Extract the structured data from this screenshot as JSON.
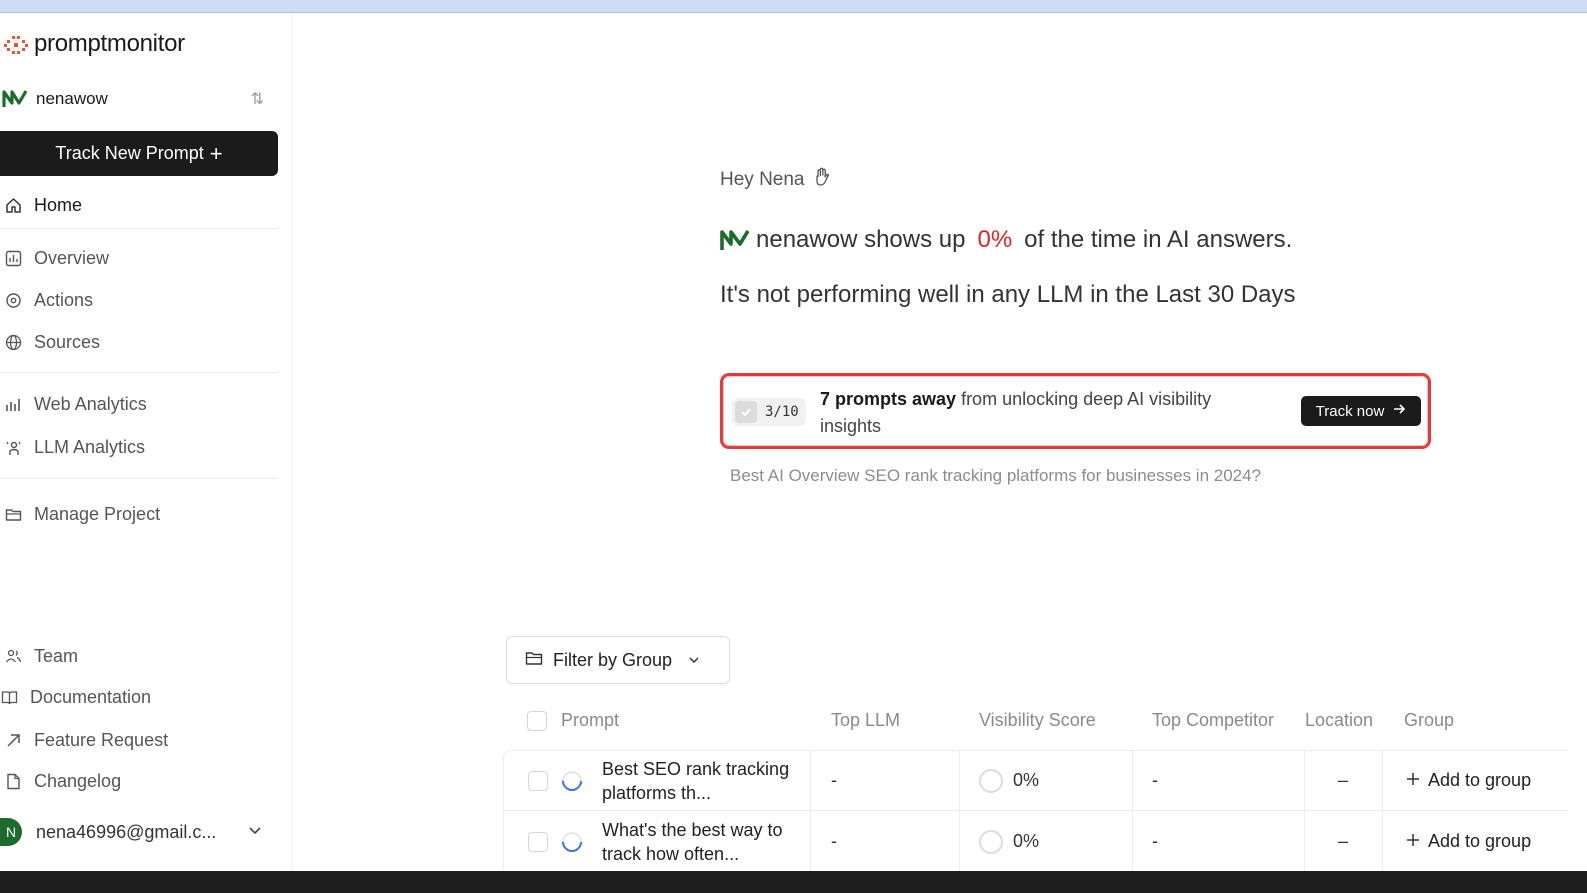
{
  "brand": {
    "name": "promptmonitor",
    "accent": "#e9532d"
  },
  "project": {
    "name": "nenawow",
    "switch_icon": "sort-arrows-icon"
  },
  "sidebar": {
    "track_button": {
      "label": "Track New Prompt",
      "icon": "+"
    },
    "items": [
      {
        "label": "Home",
        "icon": "home-icon"
      },
      {
        "label": "Overview",
        "icon": "chart-icon"
      },
      {
        "label": "Actions",
        "icon": "actions-icon"
      },
      {
        "label": "Sources",
        "icon": "globe-icon"
      },
      {
        "label": "Web Analytics",
        "icon": "bar-chart-icon"
      },
      {
        "label": "LLM Analytics",
        "icon": "sparkle-icon"
      },
      {
        "label": "Manage Project",
        "icon": "folder-icon"
      }
    ],
    "footer_items": [
      {
        "label": "Team",
        "icon": "users-icon"
      },
      {
        "label": "Documentation",
        "icon": "book-icon"
      },
      {
        "label": "Feature Request",
        "icon": "arrow-up-right-icon"
      },
      {
        "label": "Changelog",
        "icon": "file-icon"
      }
    ],
    "user": {
      "initial": "N",
      "email": "nena46996@gmail.c..."
    }
  },
  "main": {
    "greeting": "Hey Nena",
    "headline": {
      "prefix": "nenawow shows up",
      "percent": "0%",
      "suffix": "of the time in AI answers."
    },
    "subline": "It's not performing well in any LLM in the Last 30 Days",
    "callout": {
      "counter": "3/10",
      "bold": "7 prompts away",
      "text": "from unlocking deep AI visibility insights",
      "button": "Track now",
      "progress": 0.3
    },
    "typing_prompt": "Best AI Overview SEO rank tracking platforms for businesses in 2024?",
    "filter": {
      "label": "Filter by Group"
    },
    "table": {
      "headers": [
        "Prompt",
        "Top LLM",
        "Visibility Score",
        "Top Competitor",
        "Location",
        "Group"
      ],
      "rows": [
        {
          "prompt": "Best SEO rank tracking platforms th...",
          "top_llm": "-",
          "score": "0%",
          "competitor": "-",
          "location": "–",
          "group": "Add to group"
        },
        {
          "prompt": "What's the best way to track how often...",
          "top_llm": "-",
          "score": "0%",
          "competitor": "-",
          "location": "–",
          "group": "Add to group"
        }
      ]
    }
  }
}
